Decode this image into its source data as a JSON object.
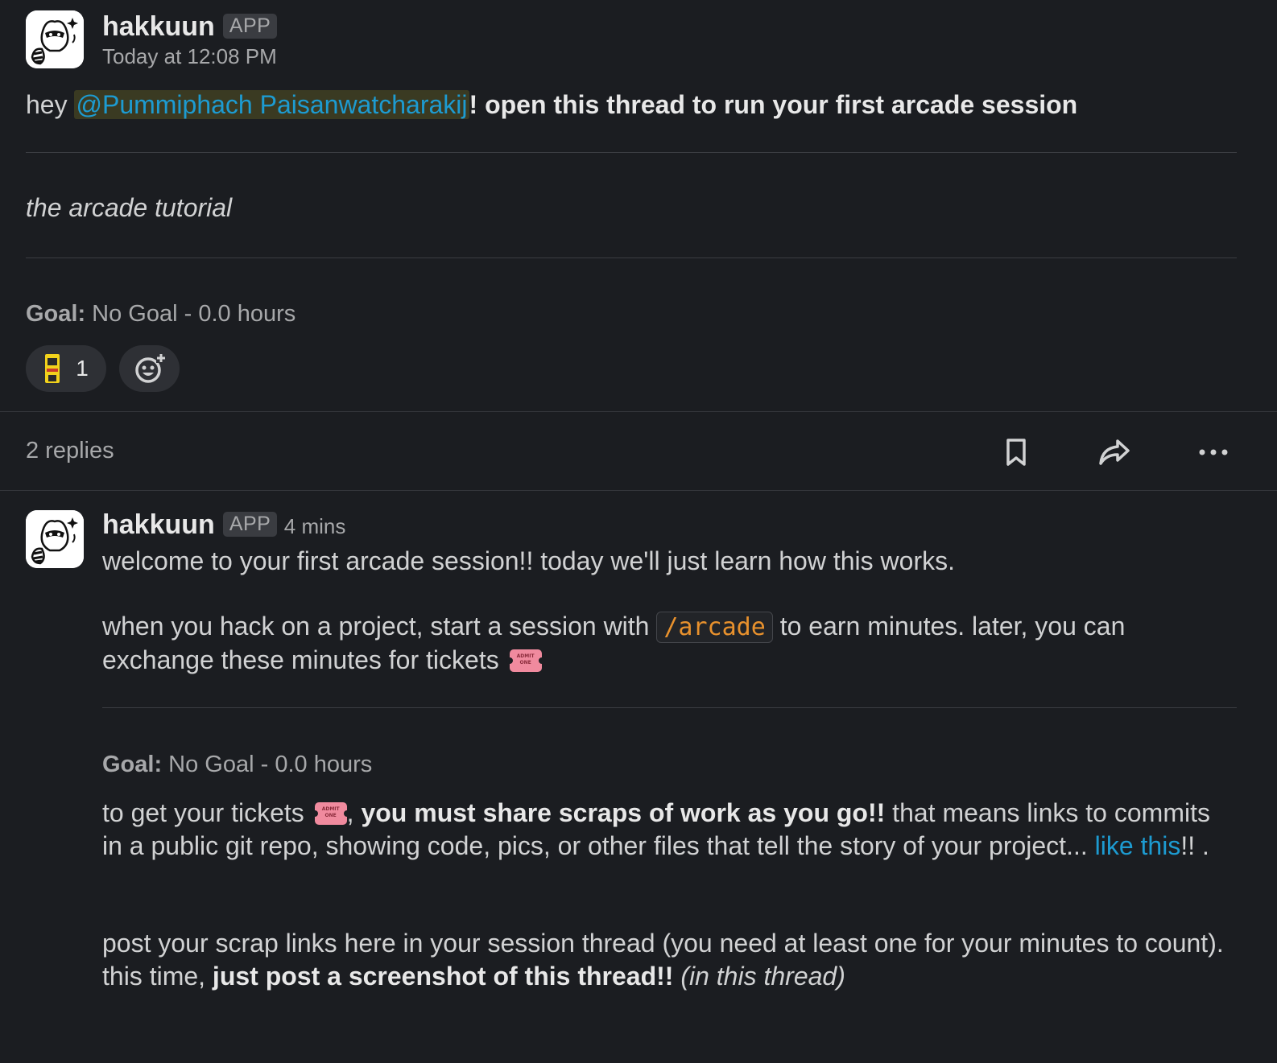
{
  "top_message": {
    "author": "hakkuun",
    "badge": "APP",
    "timestamp": "Today at 12:08 PM",
    "greeting": "hey ",
    "mention": "@Pummiphach Paisanwatcharakij",
    "exclaim": "!",
    "bold_text": " open this thread to run your first arcade session",
    "italic_title": "the arcade tutorial",
    "goal_label": "Goal:",
    "goal_value": " No Goal - 0.0 hours",
    "reaction_count": "1"
  },
  "thread_bar": {
    "replies": "2 replies"
  },
  "reply": {
    "author": "hakkuun",
    "badge": "APP",
    "timestamp": "4 mins",
    "line1": "welcome to your first arcade session!! today we'll just learn how this works.",
    "line2_a": "when you hack on a project, start a session with ",
    "line2_code": "/arcade",
    "line2_b": " to earn minutes. later, you can exchange these minutes for tickets ",
    "goal_label": "Goal:",
    "goal_value": " No Goal - 0.0 hours",
    "p3_a": "to get your tickets ",
    "p3_b": ", ",
    "p3_bold": "you must share scraps of work as you go!!",
    "p3_c": " that means links to commits in a public git repo, showing code, pics, or other files that tell the story of your project... ",
    "p3_link": "like this",
    "p3_d": "!! .",
    "p4_a": "post your scrap links here in your session thread (you need at least one for your minutes to count). this time, ",
    "p4_bold": "just post a screenshot of this thread!!",
    "p4_italic": " (in this thread)",
    "ticket_text": "ADMIT ONE"
  },
  "colors": {
    "background": "#1b1d21",
    "link": "#1d9bd1",
    "code": "#e8912d",
    "ticket": "#f08a9e"
  },
  "icons": [
    "raccoon-avatar",
    "arcade-cabinet-emoji",
    "add-reaction-icon",
    "bookmark-icon",
    "share-icon",
    "more-icon",
    "ticket-emoji"
  ]
}
